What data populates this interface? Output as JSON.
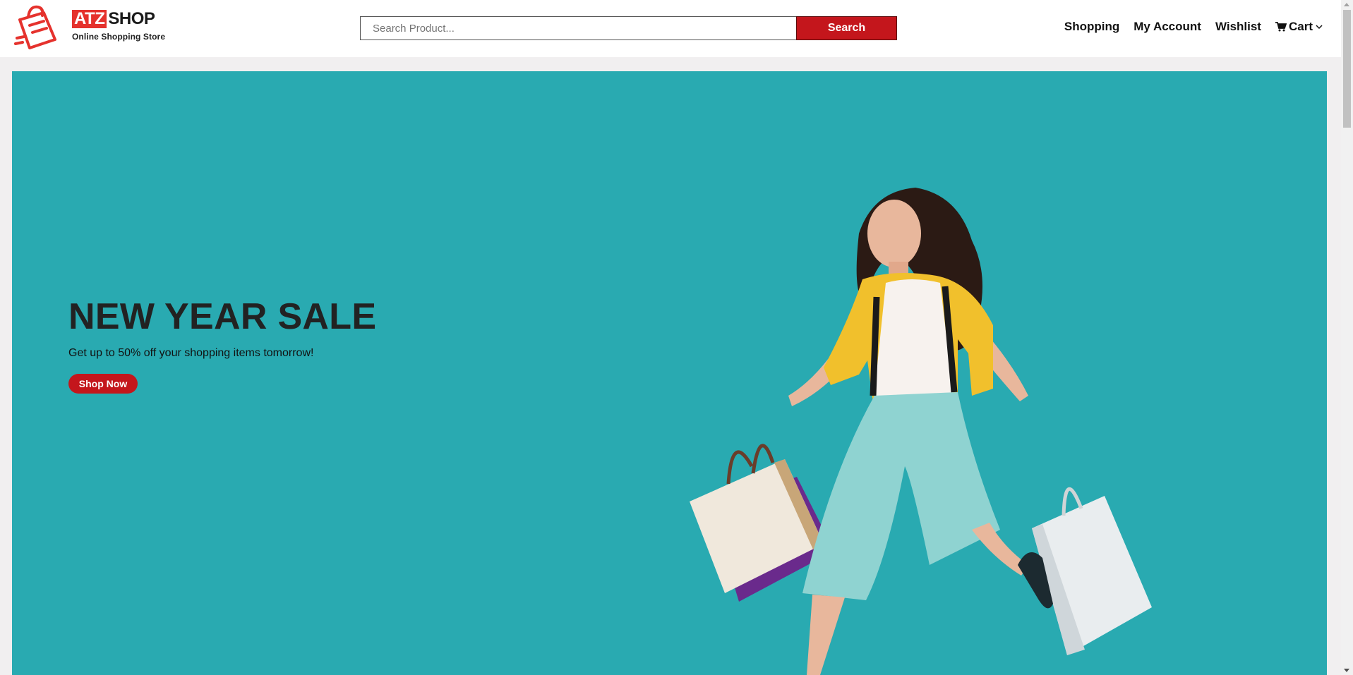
{
  "brand": {
    "logo_prefix": "ATZ",
    "logo_suffix": "SHOP",
    "tagline": "Online Shopping Store",
    "logo_icon": "shopping-bag-icon",
    "accent_color": "#e5322d"
  },
  "search": {
    "placeholder": "Search Product...",
    "value": "",
    "button_label": "Search"
  },
  "nav": {
    "items": [
      {
        "label": "Shopping"
      },
      {
        "label": "My Account"
      },
      {
        "label": "Wishlist"
      }
    ],
    "cart": {
      "label": "Cart",
      "icon": "cart-icon"
    }
  },
  "hero": {
    "title": "NEW YEAR SALE",
    "subtitle": "Get up to 50% off your shopping items tomorrow!",
    "button_label": "Shop Now",
    "background_color": "#29aab1",
    "button_color": "#c4161c"
  }
}
